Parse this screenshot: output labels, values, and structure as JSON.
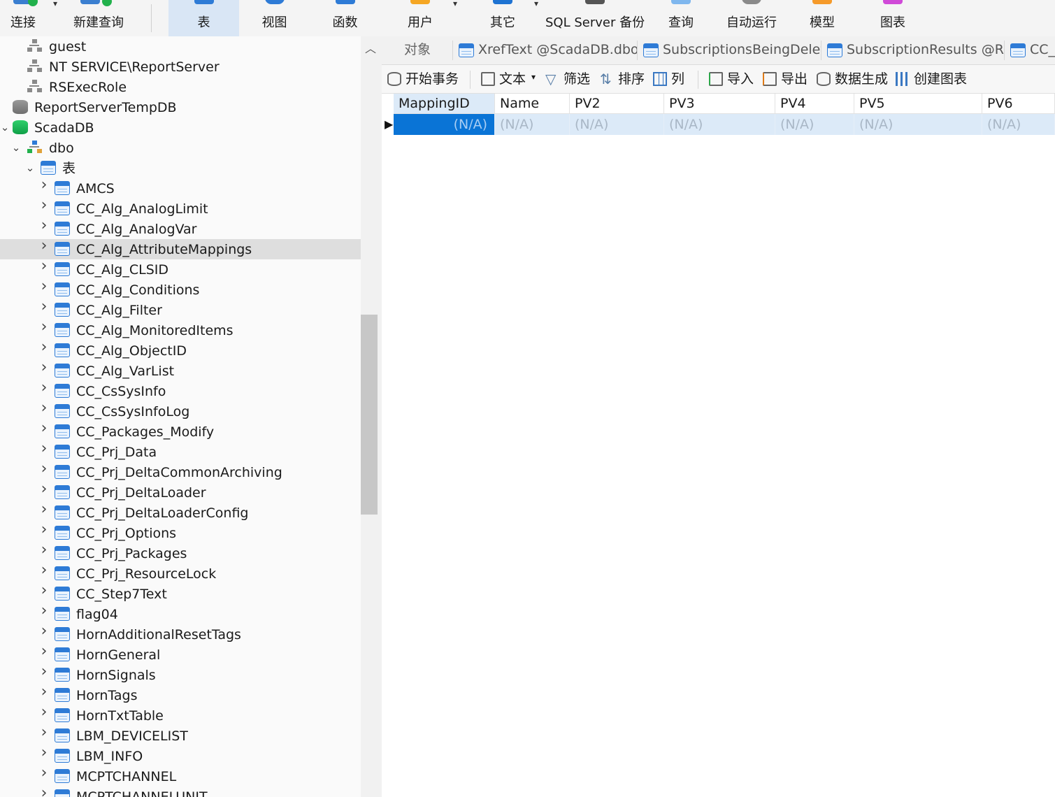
{
  "ribbon": {
    "buttons": [
      {
        "label": "连接",
        "has_dropdown": true,
        "icon": "connect-icon"
      },
      {
        "label": "新建查询",
        "icon": "new-query-icon"
      },
      {
        "label": "表",
        "active": true,
        "icon": "table-icon"
      },
      {
        "label": "视图",
        "icon": "view-icon"
      },
      {
        "label": "函数",
        "icon": "function-icon"
      },
      {
        "label": "用户",
        "has_dropdown": true,
        "icon": "user-icon"
      },
      {
        "label": "其它",
        "has_dropdown": true,
        "icon": "other-icon"
      },
      {
        "label": "SQL Server 备份",
        "icon": "backup-icon"
      },
      {
        "label": "查询",
        "icon": "query-icon"
      },
      {
        "label": "自动运行",
        "icon": "automation-icon"
      },
      {
        "label": "模型",
        "icon": "model-icon"
      },
      {
        "label": "图表",
        "icon": "chart-icon"
      }
    ]
  },
  "tree": {
    "nodes": [
      {
        "label": "guest",
        "icon": "role-icon",
        "level": 2
      },
      {
        "label": "NT SERVICE\\ReportServer",
        "icon": "role-icon",
        "level": 2
      },
      {
        "label": "RSExecRole",
        "icon": "role-icon",
        "level": 2
      },
      {
        "label": "ReportServerTempDB",
        "icon": "database-icon"
      },
      {
        "label": "ScadaDB",
        "icon": "database-icon",
        "expanded": true,
        "status": "connected"
      },
      {
        "label": "dbo",
        "icon": "schema-icon",
        "expanded": true
      },
      {
        "label": "表",
        "icon": "tables-folder-icon",
        "expanded": true
      },
      {
        "label": "AMCS",
        "icon": "table-icon"
      },
      {
        "label": "CC_Alg_AnalogLimit",
        "icon": "table-icon"
      },
      {
        "label": "CC_Alg_AnalogVar",
        "icon": "table-icon"
      },
      {
        "label": "CC_Alg_AttributeMappings",
        "icon": "table-icon",
        "selected": true
      },
      {
        "label": "CC_Alg_CLSID",
        "icon": "table-icon"
      },
      {
        "label": "CC_Alg_Conditions",
        "icon": "table-icon"
      },
      {
        "label": "CC_Alg_Filter",
        "icon": "table-icon"
      },
      {
        "label": "CC_Alg_MonitoredItems",
        "icon": "table-icon"
      },
      {
        "label": "CC_Alg_ObjectID",
        "icon": "table-icon"
      },
      {
        "label": "CC_Alg_VarList",
        "icon": "table-icon"
      },
      {
        "label": "CC_CsSysInfo",
        "icon": "table-icon"
      },
      {
        "label": "CC_CsSysInfoLog",
        "icon": "table-icon"
      },
      {
        "label": "CC_Packages_Modify",
        "icon": "table-icon"
      },
      {
        "label": "CC_Prj_Data",
        "icon": "table-icon"
      },
      {
        "label": "CC_Prj_DeltaCommonArchiving",
        "icon": "table-icon"
      },
      {
        "label": "CC_Prj_DeltaLoader",
        "icon": "table-icon"
      },
      {
        "label": "CC_Prj_DeltaLoaderConfig",
        "icon": "table-icon"
      },
      {
        "label": "CC_Prj_Options",
        "icon": "table-icon"
      },
      {
        "label": "CC_Prj_Packages",
        "icon": "table-icon"
      },
      {
        "label": "CC_Prj_ResourceLock",
        "icon": "table-icon"
      },
      {
        "label": "CC_Step7Text",
        "icon": "table-icon"
      },
      {
        "label": "flag04",
        "icon": "table-icon"
      },
      {
        "label": "HornAdditionalResetTags",
        "icon": "table-icon"
      },
      {
        "label": "HornGeneral",
        "icon": "table-icon"
      },
      {
        "label": "HornSignals",
        "icon": "table-icon"
      },
      {
        "label": "HornTags",
        "icon": "table-icon"
      },
      {
        "label": "HornTxtTable",
        "icon": "table-icon"
      },
      {
        "label": "LBM_DEVICELIST",
        "icon": "table-icon"
      },
      {
        "label": "LBM_INFO",
        "icon": "table-icon"
      },
      {
        "label": "MCPTCHANNEL",
        "icon": "table-icon"
      },
      {
        "label": "MCPTCHANNELUNIT",
        "icon": "table-icon"
      }
    ]
  },
  "tabs": [
    {
      "label": "对象",
      "plain": true
    },
    {
      "label": "XrefText @ScadaDB.dbo...",
      "icon": "table-icon"
    },
    {
      "label": "SubscriptionsBeingDelet...",
      "icon": "table-icon"
    },
    {
      "label": "SubscriptionResults @R...",
      "icon": "table-icon"
    },
    {
      "label": "CC_P",
      "icon": "table-icon"
    }
  ],
  "toolbar": [
    {
      "label": "开始事务",
      "icon": "transaction-icon"
    },
    {
      "label": "文本",
      "icon": "text-icon",
      "has_dropdown": true
    },
    {
      "label": "筛选",
      "icon": "filter-icon"
    },
    {
      "label": "排序",
      "icon": "sort-icon"
    },
    {
      "label": "列",
      "icon": "columns-icon"
    },
    {
      "label": "导入",
      "icon": "import-icon"
    },
    {
      "label": "导出",
      "icon": "export-icon"
    },
    {
      "label": "数据生成",
      "icon": "data-generation-icon"
    },
    {
      "label": "创建图表",
      "icon": "create-chart-icon"
    }
  ],
  "grid": {
    "columns": [
      "MappingID",
      "Name",
      "PV2",
      "PV3",
      "PV4",
      "PV5",
      "PV6"
    ],
    "rows": [
      [
        "(N/A)",
        "(N/A)",
        "(N/A)",
        "(N/A)",
        "(N/A)",
        "(N/A)",
        "(N/A)"
      ]
    ]
  },
  "colors": {
    "accent": "#0a74d6",
    "selection_row": "#dceaf8",
    "ribbon_active": "#d9e6f5"
  }
}
